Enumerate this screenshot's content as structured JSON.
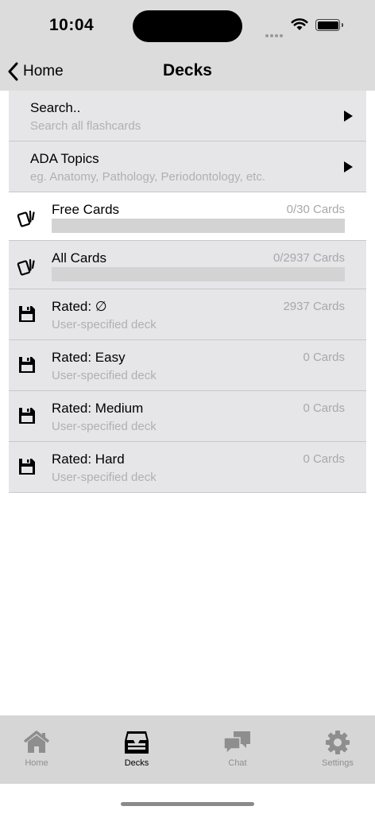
{
  "status_bar": {
    "time": "10:04"
  },
  "nav": {
    "back_label": "Home",
    "title": "Decks"
  },
  "search": {
    "title": "Search..",
    "subtitle": "Search all flashcards"
  },
  "topics": {
    "title": "ADA Topics",
    "subtitle": "eg. Anatomy, Pathology, Periodontology, etc."
  },
  "decks": [
    {
      "title": "Free Cards",
      "count": "0/30 Cards",
      "icon": "cards-icon",
      "progress": 0
    },
    {
      "title": "All Cards",
      "count": "0/2937 Cards",
      "icon": "cards-icon",
      "progress": 0
    },
    {
      "title": "Rated: ∅",
      "subtitle": "User-specified deck",
      "count": "2937 Cards",
      "icon": "floppy-disk-icon"
    },
    {
      "title": "Rated: Easy",
      "subtitle": "User-specified deck",
      "count": "0 Cards",
      "icon": "floppy-disk-icon"
    },
    {
      "title": "Rated: Medium",
      "subtitle": "User-specified deck",
      "count": "0 Cards",
      "icon": "floppy-disk-icon"
    },
    {
      "title": "Rated: Hard",
      "subtitle": "User-specified deck",
      "count": "0 Cards",
      "icon": "floppy-disk-icon"
    }
  ],
  "tabs": [
    {
      "label": "Home",
      "icon": "home-icon",
      "active": false
    },
    {
      "label": "Decks",
      "icon": "inbox-tray-icon",
      "active": true
    },
    {
      "label": "Chat",
      "icon": "chat-bubbles-icon",
      "active": false
    },
    {
      "label": "Settings",
      "icon": "gear-icon",
      "active": false
    }
  ],
  "colors": {
    "header_bg": "#dcdcdc",
    "row_bg": "#e6e6e9",
    "tab_active": "#000000",
    "tab_inactive": "#8e8e8e"
  }
}
